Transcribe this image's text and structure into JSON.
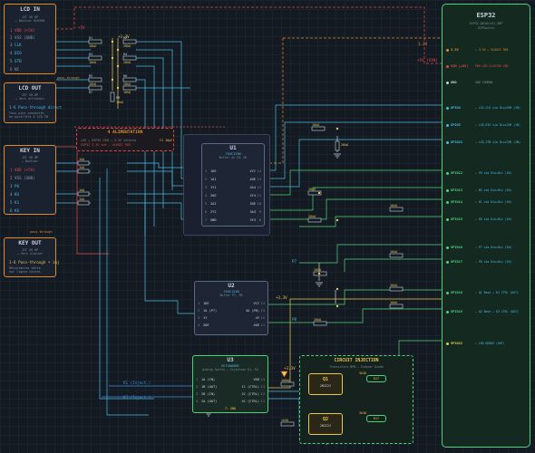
{
  "colors": {
    "bg": "#141a22",
    "orange": "#e08a2c",
    "red": "#e04848",
    "green": "#4fd27a",
    "cyan": "#4ab8e0",
    "yellow": "#e6c84a",
    "blue": "#3d8ee0",
    "purple": "#8a7ce0"
  },
  "lcd_in": {
    "title": "LCD IN",
    "sub1": "JST XH 8P",
    "sub2": "← Boitier HLK590",
    "pins": [
      "1  VDD (+5V)",
      "2  VSS (GND)",
      "3  CLK",
      "4  DIO",
      "5  STB",
      "6  NC"
    ]
  },
  "lcd_pass": "pass-through",
  "lcd_out": {
    "title": "LCD OUT",
    "sub1": "JST XH 8P",
    "sub2": "→ Vers afficheur",
    "pin": "1-6  Pass-through direct",
    "note1": "Tous pins connectés",
    "note2": "en parallèle à LCD IN"
  },
  "key_in": {
    "title": "KEY IN",
    "sub1": "JST XH 8P",
    "sub2": "← Boîtier",
    "pins": [
      "1  VDD (+5V)",
      "2  VSS (GND)",
      "3  P6",
      "4  N3",
      "5  K1",
      "6  K6"
    ]
  },
  "key_pass": "pass-through",
  "key_out": {
    "title": "KEY OUT",
    "sub1": "JST XH 6P",
    "sub2": "→ Vers clavier",
    "pin": "1-6  Pass-through + inj",
    "note1": "Résistances série",
    "note2": "sur lignes mixtes"
  },
  "alim": {
    "title": "4  ALIMENTATION",
    "l1": "+5V → ESP32 VIN → 3.3V interne",
    "l2": "ESP32 3.3V out → VLOGIC R03",
    "cap": "C1 10µF"
  },
  "esp": {
    "title": "ESP32",
    "sub": "ESP32-DEVKitV1-30P",
    "sub2": "DIPSwitch",
    "left_pins": [
      "3.3V",
      "VIN (+5V)",
      "GND",
      "GPIO4",
      "GPIO5",
      "GPIO21",
      "GPIO12",
      "GPIO13",
      "GPIO14",
      "GPIO15",
      "GPIO16",
      "GPIO17",
      "GPIO18",
      "GPIO19",
      "GPIO22"
    ],
    "right_labels": [
      "→ 3.3V → VLOGIC R03",
      "PWR LED CLAVIER VDD",
      "GND COMMUN",
      "→ LCD_CLK via Div+CHR (IN)",
      "→ LCD_DIO via Div+CHR (IN)",
      "→ LCD_STB via Div+CHR (IN)",
      "→ P6 via Div+Div (IN)",
      "→ N3 via Div+Div (IN)",
      "→ K1 via Div+Div (IN)",
      "→ K6 via Div+Div (IN)",
      "→ P7 via Div+Div (IN)",
      "→ P8 via Div+Div (IN)",
      "→ Q1 Base → K1 CTRL (OUT)",
      "→ Q2 Base → K3 CTRL (OUT)",
      "→ LED DEBUG (OUT)"
    ]
  },
  "u1": {
    "title": "U1",
    "sub": "74HC125N",
    "sub2": "Buffer 4x CH, OE",
    "left": [
      "1OE",
      "1A1",
      "1Y1",
      "2OE",
      "2A2",
      "2Y2",
      "GND"
    ],
    "right": [
      "VCC",
      "4OE",
      "4A4",
      "4Y4",
      "3OE",
      "3A3",
      "3Y3"
    ],
    "lnum": [
      "1",
      "2",
      "3",
      "4",
      "5",
      "6",
      "7"
    ],
    "rnum": [
      "14",
      "13",
      "12",
      "11",
      "10",
      "9",
      "8"
    ]
  },
  "u2": {
    "title": "U2",
    "sub": "74HC125N",
    "sub2": "Buffer P7, P8",
    "left": [
      "1OE",
      "1A (P7)",
      "1Y",
      "2OE"
    ],
    "right": [
      "VCC",
      "4A (P8)",
      "4Y",
      "4OE"
    ],
    "lnum": [
      "1",
      "2",
      "3",
      "4"
    ],
    "rnum": [
      "14",
      "13",
      "12",
      "11"
    ]
  },
  "u3": {
    "title": "U3",
    "sub": "HCF4066BE",
    "sub2": "Analog Switch – Injection K1, K3",
    "left": [
      "1A (IN)",
      "1B (OUT)",
      "2B (IN)",
      "2A (OUT)"
    ],
    "right": [
      "VDD",
      "1C (CTRL)",
      "2C (CTRL)",
      "4C (CTRL)"
    ],
    "lnum": [
      "1",
      "2",
      "3",
      "4"
    ],
    "rnum": [
      "14",
      "13",
      "12",
      "11"
    ],
    "gnd": "7: GND"
  },
  "inj": {
    "title": "CIRCUIT INJECTION",
    "sub": "Transistors NPN – Scanner Diode",
    "q1": "Q1",
    "q1p": "2N3222",
    "q2": "Q2",
    "q2p": "2N3222",
    "r1": "R17",
    "r2": "R17"
  },
  "res": {
    "r1": "R1",
    "r1v": "10kΩ",
    "r2": "R2",
    "r2v": "20kΩ",
    "r3": "R3",
    "r3v": "10kΩ",
    "r4": "R4",
    "r4v": "20kΩ",
    "r5": "R5",
    "r5v": "10kΩ",
    "r6": "R6",
    "r6v": "20kΩ",
    "r7": "R7",
    "r7v": "10kΩ",
    "r8": "R8",
    "r8v": "10kΩ"
  },
  "wires": {
    "p5v": "+5V",
    "p33": "+3.3V",
    "p33b": "3.3V",
    "p5vb": "+5V (VIN)",
    "vin": "VIN",
    "gnd": "GND",
    "k1_inj": "K1 (Inject.)",
    "k3_inj": "K3 (Inject.)",
    "p7": "P7",
    "p8": "P8"
  },
  "rvals": {
    "r1k": "1kΩ",
    "r10k": "10kΩ",
    "r20k": "20kΩ",
    "r100k": "100kΩ",
    "r1k5": "1k5Ω",
    "r3k3": "3k3Ω"
  }
}
